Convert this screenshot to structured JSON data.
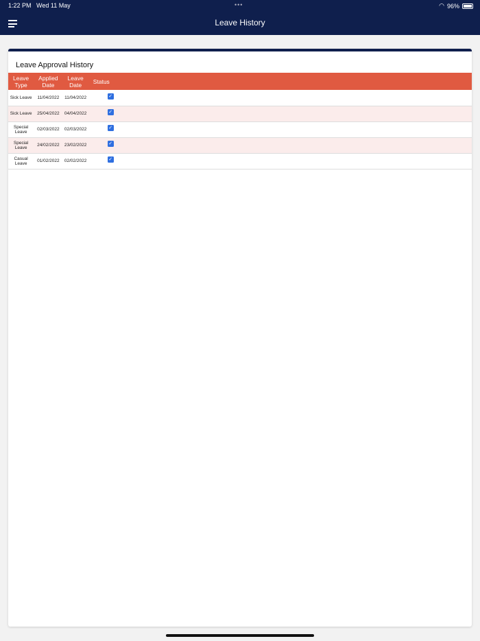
{
  "status_bar": {
    "time": "1:22 PM",
    "date": "Wed 11 May",
    "battery": "96%"
  },
  "header": {
    "title": "Leave History"
  },
  "card": {
    "title": "Leave Approval History",
    "columns": [
      "Leave Type",
      "Applied Date",
      "Leave Date",
      "Status"
    ],
    "rows": [
      {
        "type": "Sick Leave",
        "applied": "11/04/2022",
        "leave": "11/04/2022",
        "approved": true
      },
      {
        "type": "Sick Leave",
        "applied": "25/04/2022",
        "leave": "04/04/2022",
        "approved": true
      },
      {
        "type": "Special Leave",
        "applied": "02/03/2022",
        "leave": "02/03/2022",
        "approved": true
      },
      {
        "type": "Special Leave",
        "applied": "24/02/2022",
        "leave": "23/02/2022",
        "approved": true
      },
      {
        "type": "Casual Leave",
        "applied": "01/02/2022",
        "leave": "02/02/2022",
        "approved": true
      }
    ]
  },
  "colors": {
    "navy": "#0f1f4d",
    "header_red": "#e05a41",
    "checkbox": "#2f6fe0"
  }
}
